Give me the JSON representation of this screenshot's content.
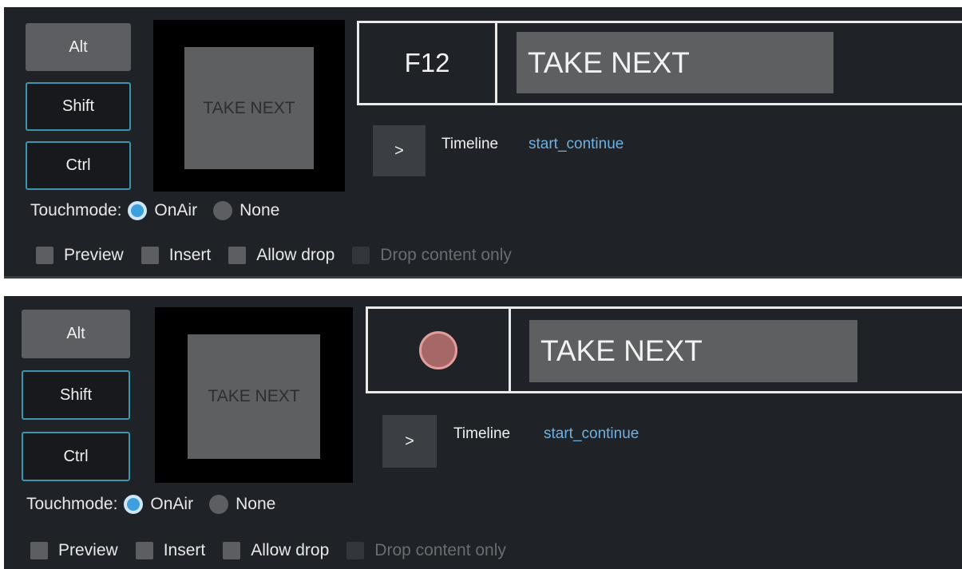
{
  "panels": [
    {
      "modifiers": {
        "alt": "Alt",
        "shift": "Shift",
        "ctrl": "Ctrl"
      },
      "preview_text": "TAKE NEXT",
      "key_text": "F12",
      "key_label": "TAKE NEXT",
      "go_button": ">",
      "timeline_label": "Timeline",
      "timeline_value": "start_continue",
      "touchmode_label": "Touchmode:",
      "touchmode_options": [
        "OnAir",
        "None"
      ],
      "touchmode_selected": "OnAir",
      "checkboxes": [
        "Preview",
        "Insert",
        "Allow drop",
        "Drop content only"
      ]
    },
    {
      "modifiers": {
        "alt": "Alt",
        "shift": "Shift",
        "ctrl": "Ctrl"
      },
      "preview_text": "TAKE NEXT",
      "key_icon": "record-icon",
      "key_label": "TAKE NEXT",
      "go_button": ">",
      "timeline_label": "Timeline",
      "timeline_value": "start_continue",
      "touchmode_label": "Touchmode:",
      "touchmode_options": [
        "OnAir",
        "None"
      ],
      "touchmode_selected": "OnAir",
      "checkboxes": [
        "Preview",
        "Insert",
        "Allow drop",
        "Drop content only"
      ]
    }
  ],
  "colors": {
    "background": "#1f2226",
    "accent_outline": "#3b95ad",
    "link": "#6fb0e0",
    "radio_selected": "#3d9fdc",
    "record": "#a66767"
  }
}
